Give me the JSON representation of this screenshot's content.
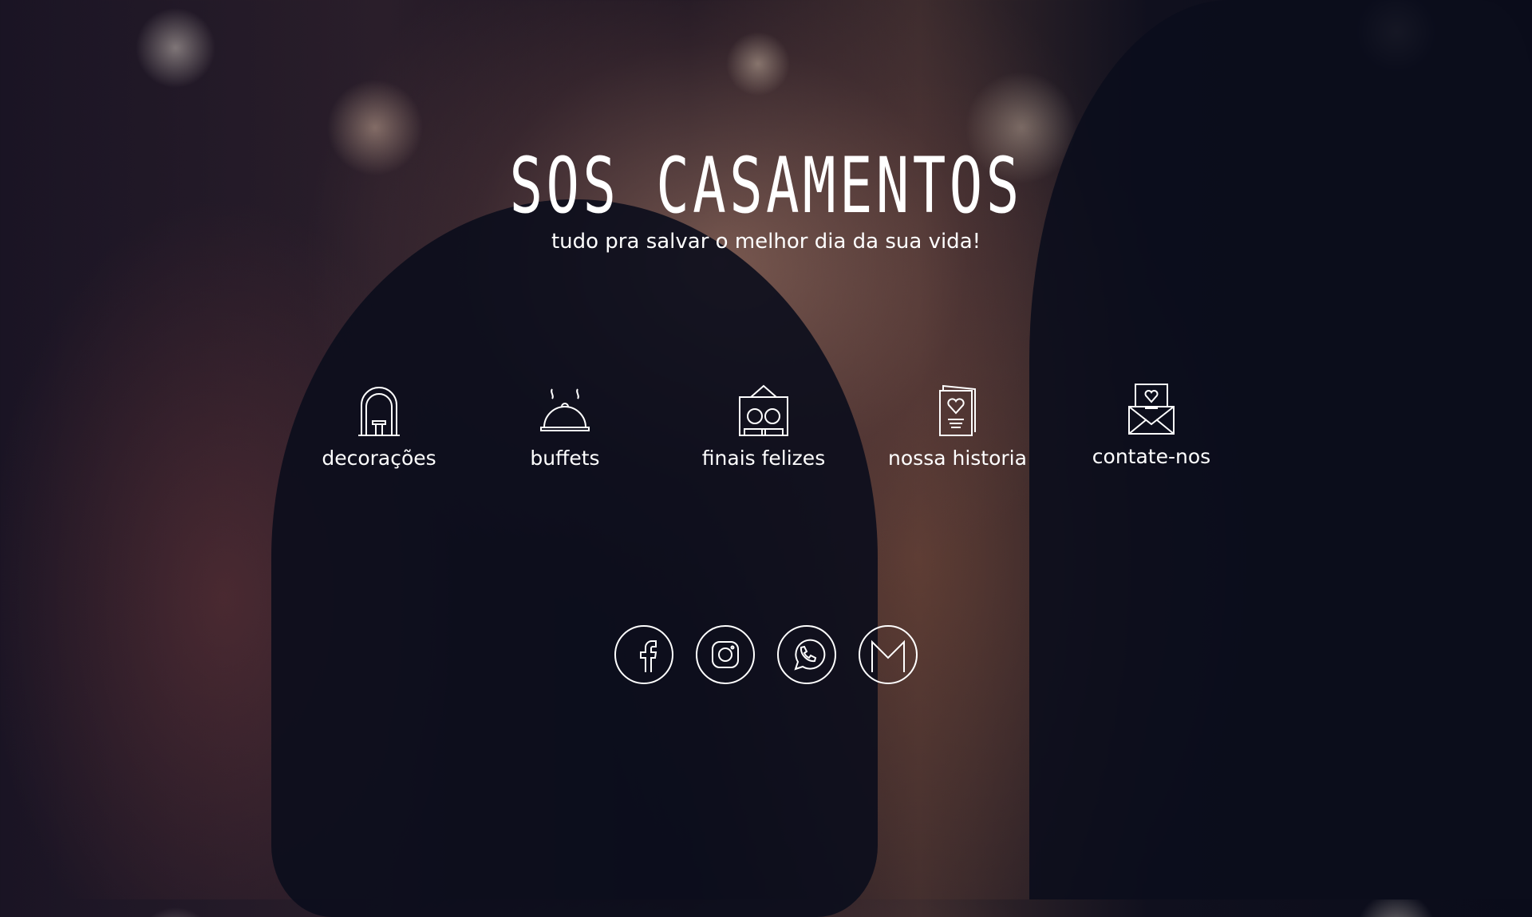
{
  "header": {
    "title": "SOS CASAMENTOS",
    "subtitle": "tudo pra salvar o melhor dia da sua vida!"
  },
  "nav": [
    {
      "label": "decorações",
      "icon": "arch-icon"
    },
    {
      "label": "buffets",
      "icon": "food-cloche-icon"
    },
    {
      "label": "finais felizes",
      "icon": "couple-portrait-icon"
    },
    {
      "label": "nossa historia",
      "icon": "heart-card-icon"
    },
    {
      "label": "contate-nos",
      "icon": "love-letter-icon"
    }
  ],
  "social": [
    "facebook-icon",
    "instagram-icon",
    "whatsapp-icon",
    "email-icon"
  ]
}
